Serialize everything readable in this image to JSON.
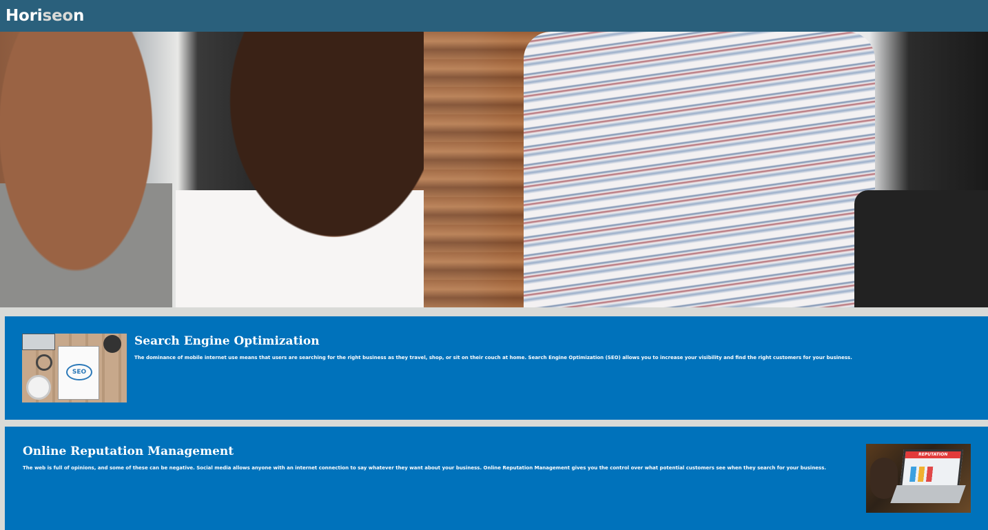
{
  "header": {
    "brand_part1": "Hori",
    "brand_part2": "seo",
    "brand_part3": "n"
  },
  "hero": {
    "alt": "Three people collaborating at a laptop"
  },
  "sections": {
    "seo": {
      "title": "Search Engine Optimization",
      "body": "The dominance of mobile internet use means that users are searching for the right business as they travel, shop, or sit on their couch at home. Search Engine Optimization (SEO) allows you to increase your visibility and find the right customers for your business.",
      "image_label": "SEO"
    },
    "reputation": {
      "title": "Online Reputation Management",
      "body": "The web is full of opinions, and some of these can be negative. Social media allows anyone with an internet connection to say whatever they want about your business. Online Reputation Management gives you the control over what potential customers see when they search for your business.",
      "image_label": "REPUTATION"
    }
  },
  "colors": {
    "header_bg": "#2a607c",
    "card_bg": "#0072bb",
    "page_bg": "#d9dad7"
  }
}
